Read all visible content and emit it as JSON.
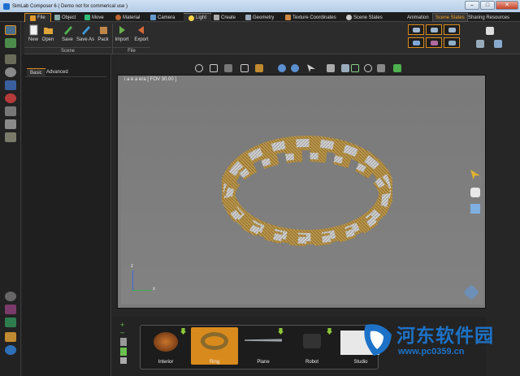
{
  "window": {
    "title": "SimLab Composer 6 ( Demo not for commerical use )",
    "min": "–",
    "max": "□",
    "close": "✕"
  },
  "menu": {
    "tabs": [
      {
        "label": "File"
      },
      {
        "label": "Object"
      },
      {
        "label": "Move"
      },
      {
        "label": "Material"
      },
      {
        "label": "Camera"
      },
      {
        "label": "Light"
      },
      {
        "label": "Create"
      },
      {
        "label": "Geometry"
      },
      {
        "label": "Texture Coordinates"
      },
      {
        "label": "Scene States"
      }
    ],
    "right_tabs": [
      {
        "label": "Animation"
      },
      {
        "label": "Scene States"
      },
      {
        "label": "Sharing Resources"
      }
    ]
  },
  "ribbon": {
    "scene_buttons": [
      {
        "label": "New"
      },
      {
        "label": "Open"
      },
      {
        "label": "Save"
      },
      {
        "label": "Save As"
      },
      {
        "label": "Pack"
      }
    ],
    "file_buttons": [
      {
        "label": "Import"
      },
      {
        "label": "Export"
      }
    ],
    "groups": {
      "scene": "Scene",
      "file": "File"
    }
  },
  "panel": {
    "tabs": [
      {
        "label": "Basic"
      },
      {
        "label": "Advanced"
      }
    ]
  },
  "viewport": {
    "header": "i  a  e    a  era   [ FOV 30.00 ]",
    "axis_x": "x",
    "axis_z": "z"
  },
  "scene_states": {
    "items": [
      {
        "label": "Interior"
      },
      {
        "label": "Ring"
      },
      {
        "label": "Plane"
      },
      {
        "label": "Robot"
      },
      {
        "label": "Studio"
      }
    ],
    "selected": "Ring"
  },
  "watermark": {
    "text": "河东软件园",
    "url": "www.pc0359.cn"
  },
  "colors": {
    "accent": "#d98a1c",
    "viewport_bg": "#7b7b7b",
    "watermark": "#1d72c7",
    "ring_gold": "#b8954a",
    "ring_silver": "#c9c9c9"
  }
}
